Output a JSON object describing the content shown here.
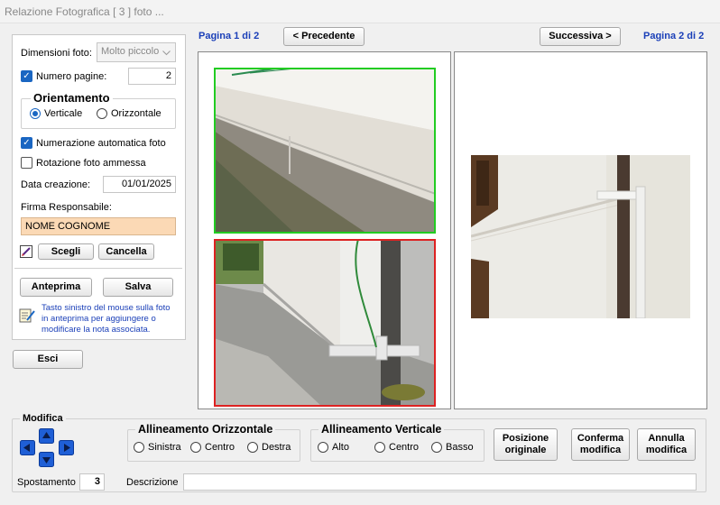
{
  "window": {
    "title": "Relazione Fotografica [ 3 ] foto ..."
  },
  "settings": {
    "photo_size_label": "Dimensioni foto:",
    "photo_size_value": "Molto piccolo",
    "page_count_label": "Numero pagine:",
    "page_count_value": "2",
    "page_count_checked": true,
    "orientation_title": "Orientamento",
    "orientation_vertical": "Verticale",
    "orientation_horizontal": "Orizzontale",
    "orientation_selected": "Verticale",
    "auto_numbering_label": "Numerazione automatica foto",
    "auto_numbering_checked": true,
    "rotation_label": "Rotazione foto ammessa",
    "rotation_checked": false,
    "creation_date_label": "Data creazione:",
    "creation_date_value": "01/01/2025",
    "signature_label": "Firma Responsabile:",
    "signature_value": "NOME COGNOME",
    "choose_button": "Scegli",
    "clear_button": "Cancella",
    "preview_button": "Anteprima",
    "save_button": "Salva",
    "hint_text": "Tasto sinistro del mouse sulla foto in anteprima per aggiungere o modificare la nota associata.",
    "exit_button": "Esci"
  },
  "pager": {
    "left_page_label": "Pagina 1 di 2",
    "prev_button": "< Precedente",
    "next_button": "Successiva >",
    "right_page_label": "Pagina 2 di 2"
  },
  "photos": {
    "photo1_border": "#22cc22",
    "photo2_border": "#dd2222"
  },
  "modify": {
    "title": "Modifica",
    "halign_title": "Allineamento Orizzontale",
    "halign_options": [
      "Sinistra",
      "Centro",
      "Destra"
    ],
    "valign_title": "Allineamento Verticale",
    "valign_options": [
      "Alto",
      "Centro",
      "Basso"
    ],
    "original_position_button": "Posizione originale",
    "confirm_button": "Conferma modifica",
    "cancel_button": "Annulla modifica",
    "shift_label": "Spostamento",
    "shift_value": "3",
    "description_label": "Descrizione",
    "description_value": ""
  }
}
